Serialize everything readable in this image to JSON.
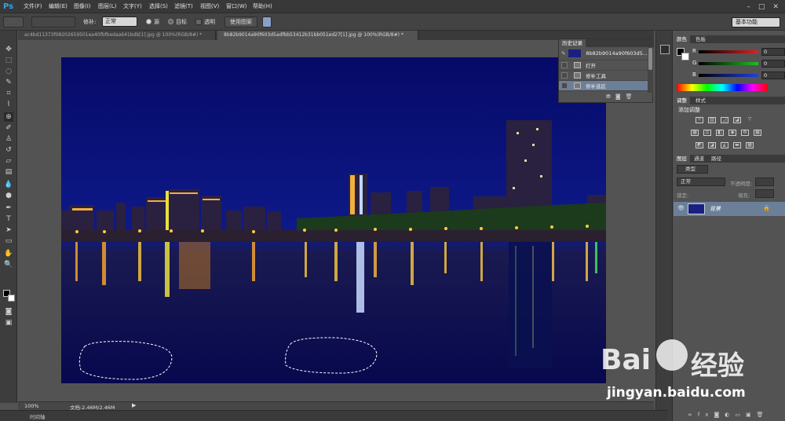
{
  "app": {
    "logo": "Ps"
  },
  "menu": [
    "文件(F)",
    "编辑(E)",
    "图像(I)",
    "图层(L)",
    "文字(Y)",
    "选择(S)",
    "滤镜(T)",
    "视图(V)",
    "窗口(W)",
    "帮助(H)"
  ],
  "options": {
    "patch_label": "修补:",
    "mode_value": "正常",
    "radio_source": "源",
    "radio_dest": "目标",
    "transparent": "透明",
    "use_pattern": "使用图案",
    "workspace": "基本功能"
  },
  "tabs": [
    {
      "label": "ac4bd11373f08202659501ea40fbfbedaa641bdb[1].jpg @ 100%(RGB/8#) *"
    },
    {
      "label": "8b82b9014a90f603d5adfbb53412b31bb051ed27[1].jpg @ 100%(RGB/8#) *"
    }
  ],
  "history": {
    "title": "历史记录",
    "snapshot": "8b82b9014a90f603d5...",
    "items": [
      "打开",
      "修补工具",
      "修补选区"
    ]
  },
  "color_panel": {
    "tabs": [
      "颜色",
      "色板"
    ],
    "channels": [
      {
        "label": "R",
        "value": "0",
        "color": "#e02020"
      },
      {
        "label": "G",
        "value": "0",
        "color": "#20c020"
      },
      {
        "label": "B",
        "value": "0",
        "color": "#2040e0"
      }
    ]
  },
  "adjust_panel": {
    "tabs": [
      "调整",
      "样式"
    ],
    "title": "添加调整"
  },
  "layers_panel": {
    "tabs": [
      "图层",
      "通道",
      "路径"
    ],
    "kind": "类型",
    "blend": "正常",
    "opacity_label": "不透明度:",
    "lock_label": "锁定:",
    "fill_label": "填充:",
    "layer_name": "背景"
  },
  "status": {
    "zoom": "100%",
    "doc": "文档:2.46M/2.46M"
  },
  "timeline": "时间轴",
  "watermark": {
    "brand": "Bai",
    "brand2": "经验",
    "url": "jingyan.baidu.com"
  }
}
